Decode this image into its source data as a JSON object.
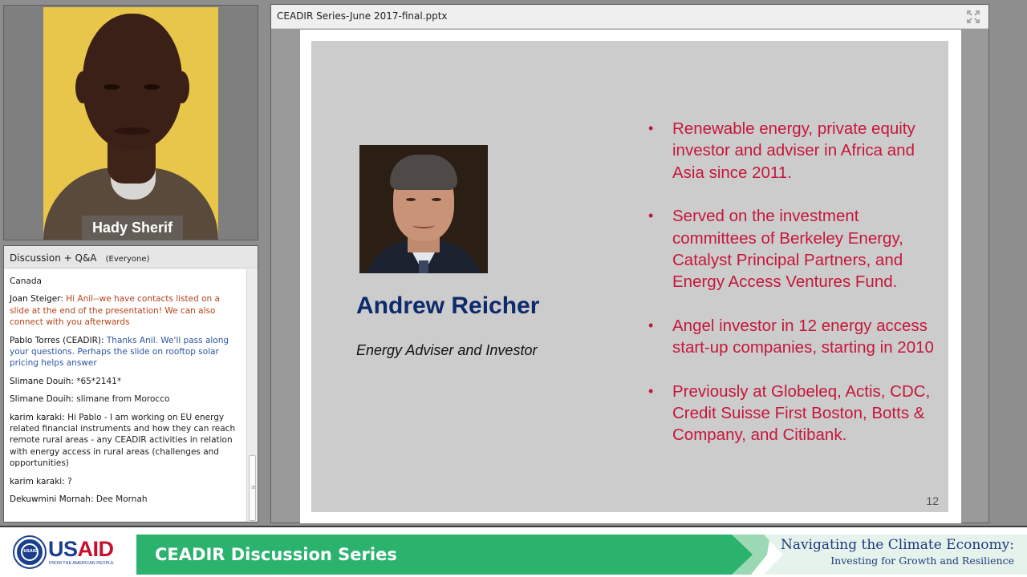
{
  "video": {
    "presenter_name": "Hady Sherif"
  },
  "chat": {
    "title": "Discussion + Q&A",
    "scope": "(Everyone)",
    "messages": [
      {
        "sender": "",
        "text": "Canada",
        "role": "attendee"
      },
      {
        "sender": "Joan Steiger:",
        "text": "Hi Anil--we have contacts listed on a slide at the end of the presentation! We can also connect with you afterwards",
        "role": "host"
      },
      {
        "sender": "Pablo Torres (CEADIR):",
        "text": "Thanks Anil. We'll pass along your questions. Perhaps the slide on rooftop solar pricing helps answer",
        "role": "presenter"
      },
      {
        "sender": "Slimane Douih:",
        "text": "*65*2141*",
        "role": "attendee"
      },
      {
        "sender": "Slimane Douih:",
        "text": "slimane from Morocco",
        "role": "attendee"
      },
      {
        "sender": "karim karaki:",
        "text": "Hi Pablo - I am working on EU energy related financial instruments and how they can reach remote rural areas - any CEADIR activities in relation with energy access in rural areas (challenges and opportunities)",
        "role": "attendee"
      },
      {
        "sender": "karim karaki:",
        "text": "?",
        "role": "attendee"
      },
      {
        "sender": "Dekuwmini Mornah:",
        "text": "Dee Mornah",
        "role": "attendee"
      }
    ]
  },
  "share": {
    "file_title": "CEADIR Series-June 2017-final.pptx",
    "slide": {
      "speaker_name": "Andrew Reicher",
      "speaker_title": "Energy Adviser and Investor",
      "bullets": [
        "Renewable energy, private equity investor and adviser in Africa and Asia since 2011.",
        "Served on the investment committees of Berkeley Energy, Catalyst Principal Partners, and Energy Access Ventures Fund.",
        "Angel investor in 12 energy access start-up companies, starting in 2010",
        "Previously at Globeleq,  Actis, CDC, Credit Suisse First Boston, Botts & Company, and Citibank."
      ],
      "slide_number": "12"
    }
  },
  "footer": {
    "usaid_prefix": "US",
    "usaid_suffix": "AID",
    "usaid_tagline": "FROM THE AMERICAN PEOPLE",
    "seal_text": "USAID",
    "series_title": "CEADIR Discussion Series",
    "theme_title": "Navigating the Climate Economy:",
    "theme_subtitle": "Investing for Growth and Resilience"
  },
  "colors": {
    "banner_green": "#2bb36e",
    "slide_bullet_red": "#c5173a",
    "speaker_name_navy": "#0d2a6b",
    "usaid_blue": "#1b3f8f",
    "usaid_red": "#c8102e",
    "host_message": "#b5431a",
    "presenter_message": "#2c56a2"
  },
  "icons": {
    "fullscreen": "fullscreen-icon",
    "scroll_grip": "scroll-grip-icon"
  }
}
